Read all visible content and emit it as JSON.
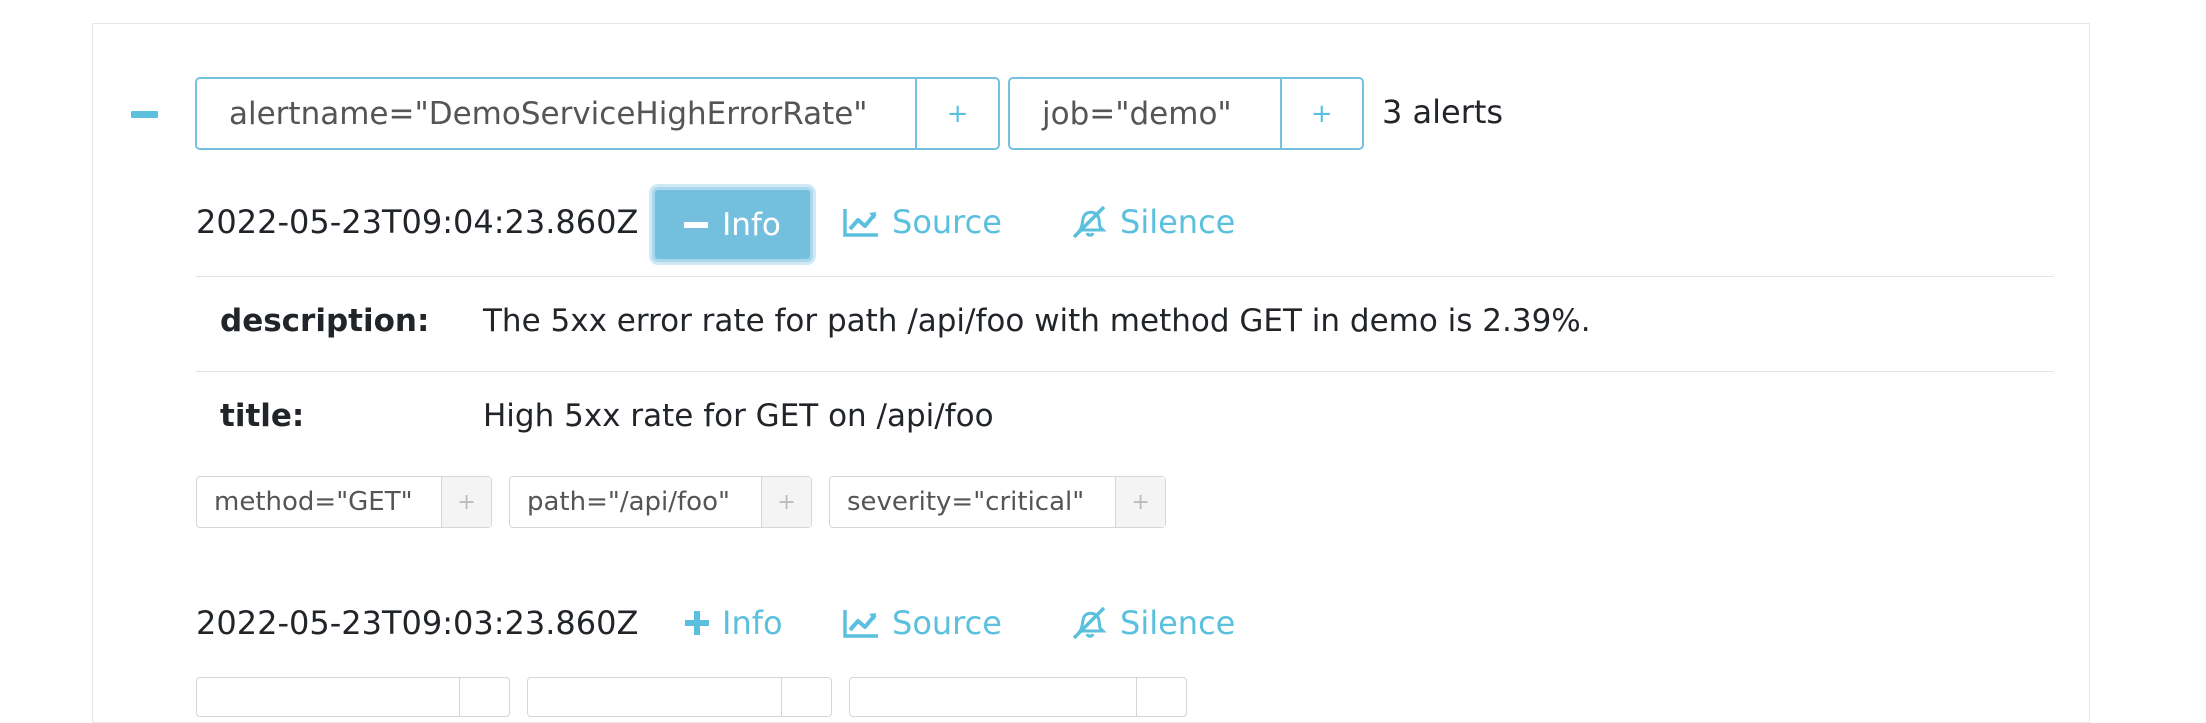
{
  "group": {
    "labels": [
      {
        "text": "alertname=\"DemoServiceHighErrorRate\"",
        "add": "+"
      },
      {
        "text": "job=\"demo\"",
        "add": "+"
      }
    ],
    "count_text": "3 alerts"
  },
  "alerts": [
    {
      "timestamp": "2022-05-23T09:04:23.860Z",
      "info_label": "Info",
      "info_expanded": true,
      "source_label": "Source",
      "silence_label": "Silence",
      "annotations": [
        {
          "key": "description:",
          "value": "The 5xx error rate for path /api/foo with method GET in demo is 2.39%."
        },
        {
          "key": "title:",
          "value": "High 5xx rate for GET on /api/foo"
        }
      ],
      "labels": [
        {
          "text": "method=\"GET\"",
          "add": "+"
        },
        {
          "text": "path=\"/api/foo\"",
          "add": "+"
        },
        {
          "text": "severity=\"critical\"",
          "add": "+"
        }
      ]
    },
    {
      "timestamp": "2022-05-23T09:03:23.860Z",
      "info_label": "Info",
      "info_expanded": false,
      "source_label": "Source",
      "silence_label": "Silence"
    }
  ],
  "icons": {
    "collapse": "minus-icon",
    "expand": "plus-icon",
    "source": "line-chart-icon",
    "silence": "bell-slash-icon"
  },
  "colors": {
    "accent": "#5bc0de",
    "active_button": "#74bfde",
    "pill_border": "#74c2e0"
  }
}
